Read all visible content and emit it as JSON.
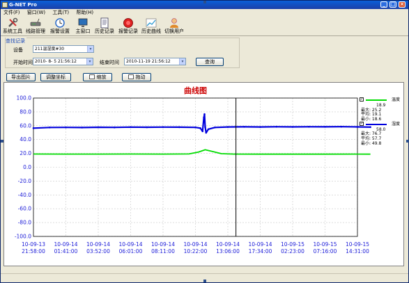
{
  "app": {
    "title": "G-NET Pro"
  },
  "window_controls": [
    "_",
    "□",
    "×"
  ],
  "menu": [
    {
      "label": "文件(F)"
    },
    {
      "label": "窗口(W)"
    },
    {
      "label": "工具(T)"
    },
    {
      "label": "帮助(H)"
    }
  ],
  "toolbar": [
    {
      "label": "系统工具",
      "icon": "tools-icon"
    },
    {
      "label": "线路管理",
      "icon": "router-icon"
    },
    {
      "label": "报警设置",
      "icon": "alarm-clock-icon"
    },
    {
      "label": "主窗口",
      "icon": "monitor-icon"
    },
    {
      "label": "历史记录",
      "icon": "document-icon"
    },
    {
      "label": "报警记录",
      "icon": "alarm-bell-icon"
    },
    {
      "label": "历史曲线",
      "icon": "chart-icon"
    },
    {
      "label": "切换用户",
      "icon": "user-icon"
    }
  ],
  "query": {
    "group_label": "查找记录",
    "device_label": "设备",
    "device_value": "211温湿度#30",
    "start_label": "开始时间",
    "start_value": "2010- 8- 5 21:56:12",
    "end_label": "结束时间",
    "end_value": "2010-11-19 21:56:12",
    "query_button": "查询"
  },
  "actions": {
    "export_label": "导出图片",
    "adjust_label": "调整坐标",
    "zoom_label": "缩放",
    "drag_label": "拖动"
  },
  "colors": {
    "title": "#cc0000",
    "axis_text": "#1a1ad8",
    "temperature": "#00dd00",
    "humidity": "#0000dd",
    "cursor": "#000000"
  },
  "chart_data": {
    "type": "line",
    "title": "曲线图",
    "ylim": [
      -100,
      100
    ],
    "yticks": [
      "100.0",
      "80.0",
      "60.0",
      "40.0",
      "20.0",
      "0.0",
      "-20.0",
      "-40.0",
      "-60.0",
      "-80.0",
      "-100.0"
    ],
    "ytick_values": [
      100,
      80,
      60,
      40,
      20,
      0,
      -20,
      -40,
      -60,
      -80,
      -100
    ],
    "xticks": [
      {
        "date": "10-09-13",
        "time": "21:58:00"
      },
      {
        "date": "10-09-14",
        "time": "01:41:00"
      },
      {
        "date": "10-09-14",
        "time": "03:52:00"
      },
      {
        "date": "10-09-14",
        "time": "06:01:00"
      },
      {
        "date": "10-09-14",
        "time": "08:11:00"
      },
      {
        "date": "10-09-14",
        "time": "10:22:00"
      },
      {
        "date": "10-09-14",
        "time": "13:06:00"
      },
      {
        "date": "10-09-14",
        "time": "17:34:00"
      },
      {
        "date": "10-09-15",
        "time": "02:23:00"
      },
      {
        "date": "10-09-15",
        "time": "07:16:00"
      },
      {
        "date": "10-09-15",
        "time": "14:31:00"
      }
    ],
    "grid": true,
    "cursor_at_tick": 6.25,
    "series": [
      {
        "name": "温度",
        "color": "#00dd00",
        "current": "18.9",
        "max_label": "最大: 25.2",
        "avg_label": "平均: 19.1",
        "min_label": "最小: 18.6",
        "points": [
          [
            0,
            19.1
          ],
          [
            1,
            19.0
          ],
          [
            2,
            19.0
          ],
          [
            3,
            19.1
          ],
          [
            4,
            19.0
          ],
          [
            4.8,
            19.2
          ],
          [
            5.1,
            22.0
          ],
          [
            5.3,
            25.2
          ],
          [
            5.55,
            22.5
          ],
          [
            5.8,
            19.6
          ],
          [
            6.2,
            19.0
          ],
          [
            7,
            18.9
          ],
          [
            8,
            18.9
          ],
          [
            9,
            18.9
          ],
          [
            10,
            19.0
          ],
          [
            10.4,
            18.9
          ]
        ]
      },
      {
        "name": "湿度",
        "color": "#0000dd",
        "current": "58.0",
        "max_label": "最大: 76.7",
        "avg_label": "平均: 57.7",
        "min_label": "最小: 49.8",
        "points": [
          [
            0,
            56.5
          ],
          [
            0.5,
            57.5
          ],
          [
            1,
            57.6
          ],
          [
            1.5,
            57.4
          ],
          [
            2,
            57.8
          ],
          [
            2.5,
            57.6
          ],
          [
            3,
            58.0
          ],
          [
            3.5,
            57.8
          ],
          [
            4,
            58.0
          ],
          [
            4.5,
            57.9
          ],
          [
            5,
            57.6
          ],
          [
            5.15,
            56.5
          ],
          [
            5.22,
            52
          ],
          [
            5.26,
            72
          ],
          [
            5.28,
            76.7
          ],
          [
            5.3,
            58
          ],
          [
            5.33,
            49.8
          ],
          [
            5.4,
            55
          ],
          [
            5.6,
            57.5
          ],
          [
            6,
            58.2
          ],
          [
            6.5,
            58.4
          ],
          [
            7,
            58.2
          ],
          [
            7.5,
            58.5
          ],
          [
            8,
            58.3
          ],
          [
            8.5,
            58.5
          ],
          [
            9,
            58.4
          ],
          [
            9.5,
            58.6
          ],
          [
            10,
            58.3
          ],
          [
            10.4,
            58.0
          ]
        ]
      }
    ]
  }
}
